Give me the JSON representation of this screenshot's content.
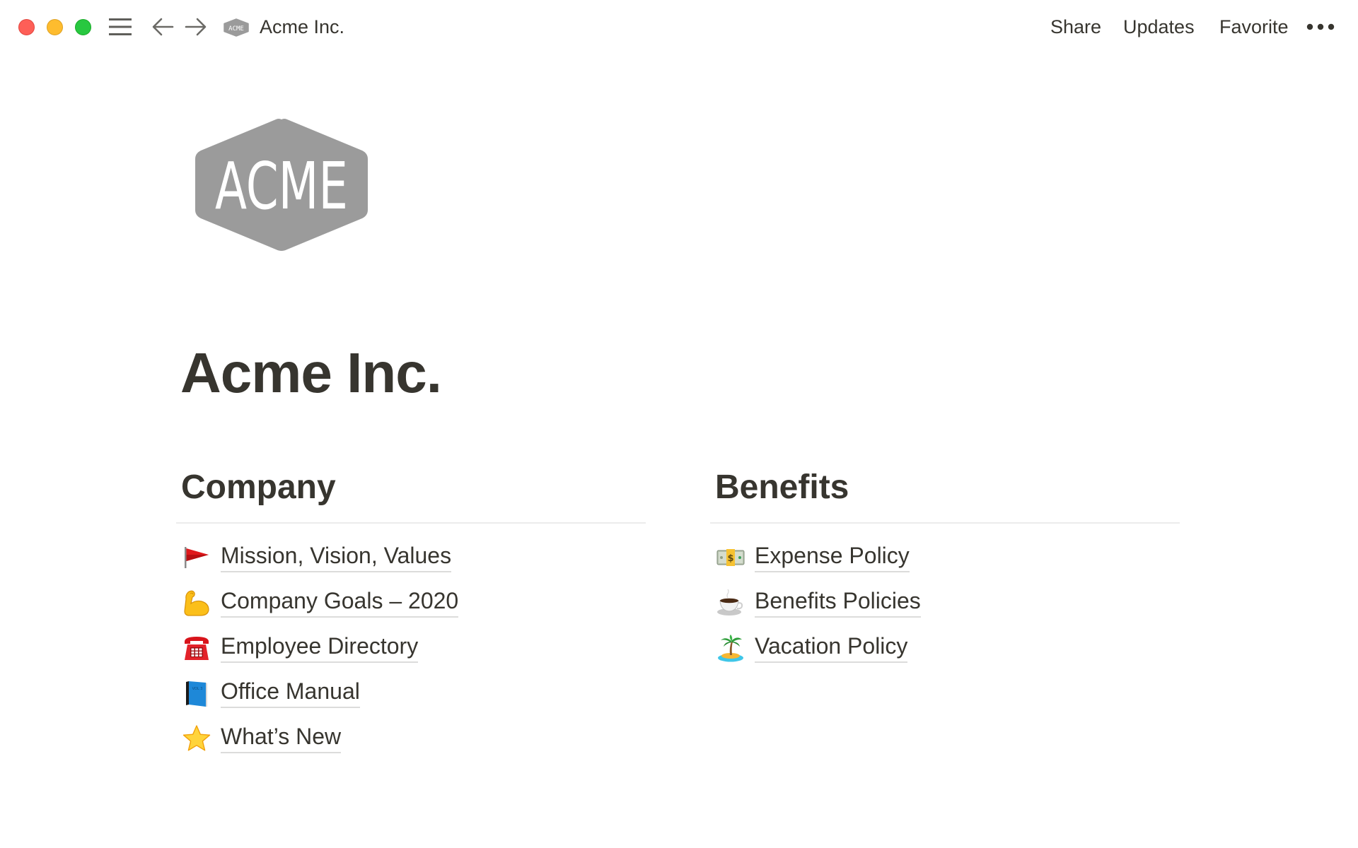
{
  "window": {
    "traffic_lights": [
      {
        "name": "close",
        "color": "#fe5f57"
      },
      {
        "name": "minimize",
        "color": "#febc2e"
      },
      {
        "name": "maximize",
        "color": "#28c840"
      }
    ]
  },
  "topbar": {
    "menu_icon": "hamburger-menu-icon",
    "back_icon": "arrow-left-icon",
    "forward_icon": "arrow-right-icon",
    "breadcrumb_logo_text": "ACME",
    "breadcrumb_title": "Acme Inc.",
    "actions": {
      "share": "Share",
      "updates": "Updates",
      "favorite": "Favorite"
    },
    "more_icon": "more-horizontal-icon"
  },
  "page": {
    "logo_text": "ACME",
    "logo_color": "#9b9b9b",
    "title": "Acme Inc.",
    "text_color": "#37352f"
  },
  "sections": {
    "company": {
      "heading": "Company",
      "items": [
        {
          "emoji": "🚩",
          "icon": "triangular-flag-icon",
          "label": "Mission, Vision, Values"
        },
        {
          "emoji": "💪",
          "icon": "flexed-biceps-icon",
          "label": "Company Goals – 2020"
        },
        {
          "emoji": "☎️",
          "icon": "telephone-icon",
          "label": "Employee Directory"
        },
        {
          "emoji": "📘",
          "icon": "blue-book-icon",
          "label": "Office Manual"
        },
        {
          "emoji": "⭐",
          "icon": "star-icon",
          "label": "What’s New"
        }
      ]
    },
    "benefits": {
      "heading": "Benefits",
      "items": [
        {
          "emoji": "💵",
          "icon": "dollar-banknote-icon",
          "label": "Expense Policy"
        },
        {
          "emoji": "☕",
          "icon": "hot-beverage-icon",
          "label": "Benefits Policies"
        },
        {
          "emoji": "🏝️",
          "icon": "desert-island-icon",
          "label": "Vacation Policy"
        }
      ]
    }
  }
}
